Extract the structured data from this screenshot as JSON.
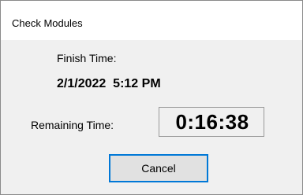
{
  "window": {
    "title": "Check Modules"
  },
  "finish": {
    "label": "Finish Time:",
    "value": "2/1/2022  5:12 PM"
  },
  "remaining": {
    "label": "Remaining Time:",
    "value": "0:16:38"
  },
  "actions": {
    "cancel_label": "Cancel"
  },
  "colors": {
    "accent": "#0078d7",
    "dialog_bg": "#f0f0f0",
    "titlebar_bg": "#ffffff"
  }
}
